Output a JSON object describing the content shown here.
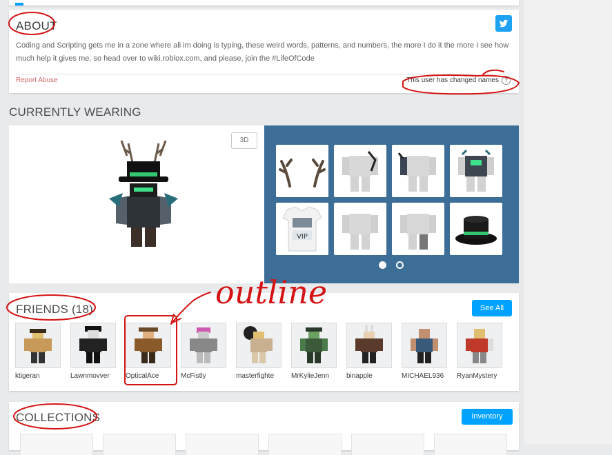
{
  "about": {
    "title": "ABOUT",
    "body": "Coding and Scripting gets me in a zone where all im doing is typing, these weird words, patterns, and numbers, the more I do it the more I see how much help it gives me, so head over to wiki.roblox.com, and please, join the #LifeOfCode",
    "report": "Report Abuse",
    "changed": "This user has changed names",
    "help_glyph": "?",
    "social_icon": "twitter-icon"
  },
  "wearing": {
    "title": "CURRENTLY WEARING",
    "btn3d": "3D",
    "items": [
      "antlers-icon",
      "shirt-icon",
      "arms-icon",
      "torso-icon",
      "vip-tshirt-icon",
      "left-arm-icon",
      "right-arm-icon",
      "top-hat-icon"
    ],
    "vip_text": "VIP",
    "page_dots": 2,
    "active_dot": 1
  },
  "friends": {
    "title": "FRIENDS (18)",
    "see_all": "See All",
    "list": [
      "ktigeran",
      "Lawnmovver",
      "OpticalAce",
      "McFistly",
      "masterfighte",
      "MrKylieJenn",
      "binapple",
      "MICHAEL936",
      "RyanMystery"
    ]
  },
  "collections": {
    "title": "COLLECTIONS",
    "inventory": "Inventory"
  },
  "annotation": {
    "word": "outline",
    "color": "#d41414"
  }
}
